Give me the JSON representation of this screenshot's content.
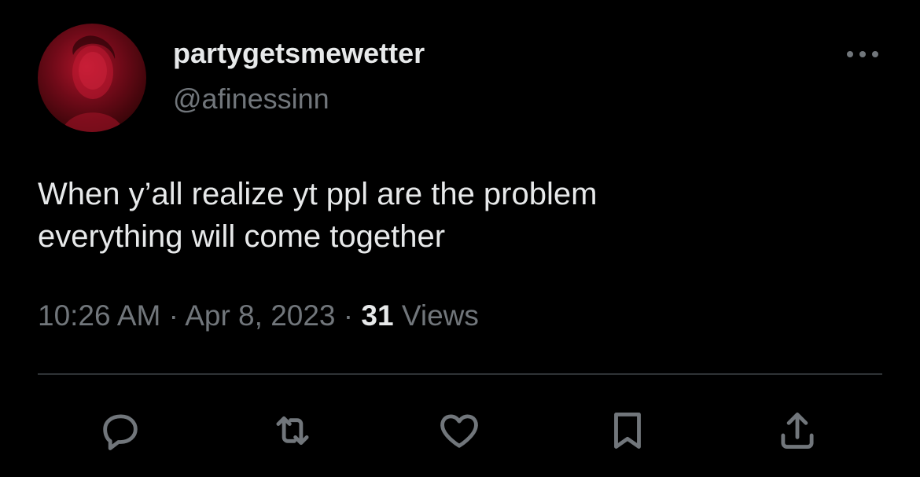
{
  "tweet": {
    "display_name": "partygetsmewetter",
    "handle": "@afinessinn",
    "text_lines": [
      "When y’all realize yt ppl are the problem",
      "everything will come together"
    ],
    "time": "10:26 AM",
    "separator": "·",
    "date": "Apr 8, 2023",
    "views_count": "31",
    "views_label": "Views"
  },
  "icons": {
    "more": "more-horizontal-icon",
    "reply": "reply-icon",
    "retweet": "retweet-icon",
    "like": "heart-icon",
    "bookmark": "bookmark-icon",
    "share": "share-icon"
  },
  "colors": {
    "background": "#000000",
    "primary_text": "#e7e9ea",
    "secondary_text": "#71767b",
    "divider": "#2f3336",
    "avatar_tint": "#8b0f1f"
  }
}
